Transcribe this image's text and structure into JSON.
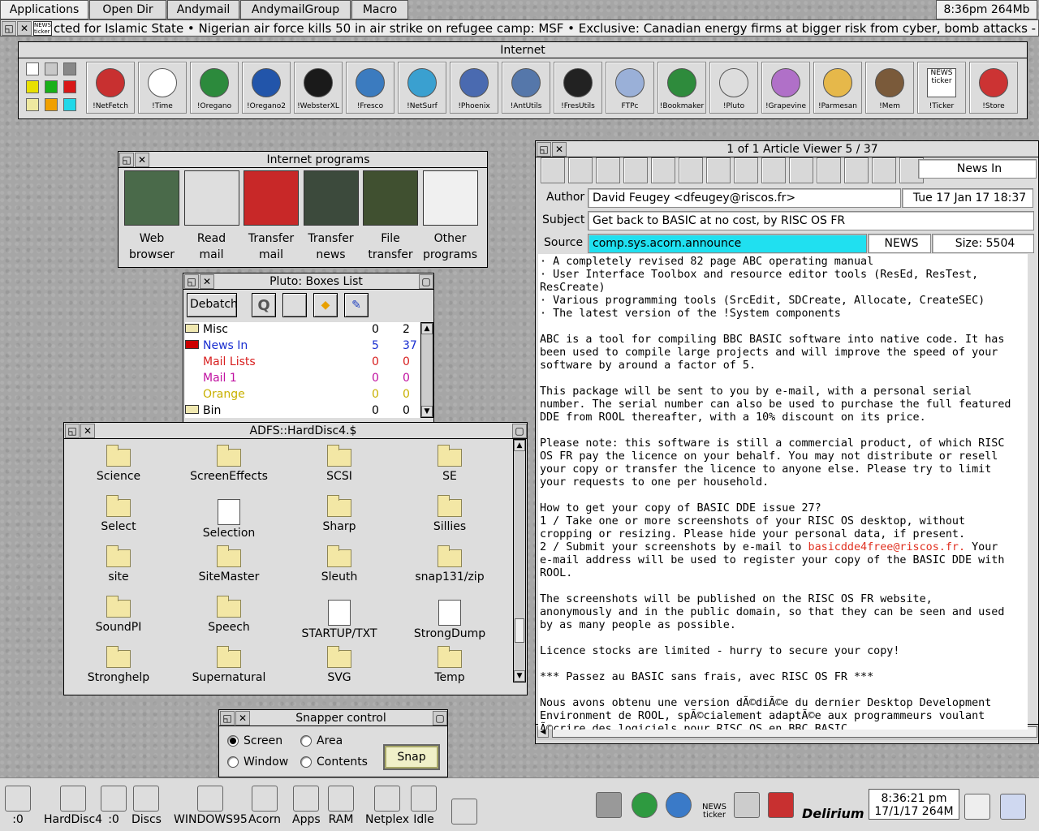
{
  "menubar": {
    "items": [
      "Applications",
      "Open Dir",
      "Andymail",
      "AndymailGroup",
      "Macro"
    ],
    "status": "8:36pm  264Mb"
  },
  "ticker": {
    "text": "cted for Islamic State  •  Nigerian air force kills 50 in air strike on refugee camp: MSF  •  Exclusive: Canadian energy firms at bigger risk from cyber, bomb attacks - spy agency  •  U.S",
    "badge": "NEWS ticker"
  },
  "internet": {
    "title": "Internet",
    "apps": [
      {
        "label": "!NetFetch",
        "icon": "netfetch-icon",
        "color": "#c83030"
      },
      {
        "label": "!Time",
        "icon": "clock-icon",
        "color": "#ffffff"
      },
      {
        "label": "!Oregano",
        "icon": "globe-icon",
        "color": "#2c8a3c"
      },
      {
        "label": "!Oregano2",
        "icon": "oregano2-icon",
        "color": "#2255aa"
      },
      {
        "label": "!WebsterXL",
        "icon": "webster-icon",
        "color": "#1a1a1a"
      },
      {
        "label": "!Fresco",
        "icon": "earth-icon",
        "color": "#3b7bbf"
      },
      {
        "label": "!NetSurf",
        "icon": "netsurf-icon",
        "color": "#3aa0d0"
      },
      {
        "label": "!Phoenix",
        "icon": "phoenix-icon",
        "color": "#4a6ab0"
      },
      {
        "label": "!AntUtils",
        "icon": "antutils-icon",
        "color": "#5577aa"
      },
      {
        "label": "!FresUtils",
        "icon": "tools-icon",
        "color": "#222222"
      },
      {
        "label": "FTPc",
        "icon": "ftp-icon",
        "color": "#9ab0d8"
      },
      {
        "label": "!Bookmaker",
        "icon": "book-icon",
        "color": "#2e8b3c"
      },
      {
        "label": "!Pluto",
        "icon": "pluto-icon",
        "color": "#dddddd"
      },
      {
        "label": "!Grapevine",
        "icon": "grapes-icon",
        "color": "#b070c8"
      },
      {
        "label": "!Parmesan",
        "icon": "cheese-icon",
        "color": "#e6b84a"
      },
      {
        "label": "!Mem",
        "icon": "photo-icon",
        "color": "#7a5a3a"
      },
      {
        "label": "!Ticker",
        "icon": "news-ticker-icon",
        "color": "#eeeeee"
      },
      {
        "label": "!Store",
        "icon": "store-icon",
        "color": "#cc3333"
      }
    ],
    "ticker_label": "NEWS ticker"
  },
  "programs": {
    "title": "Internet programs",
    "items": [
      {
        "l1": "Web",
        "l2": "browser"
      },
      {
        "l1": "Read",
        "l2": "mail"
      },
      {
        "l1": "Transfer",
        "l2": "mail"
      },
      {
        "l1": "Transfer",
        "l2": "news"
      },
      {
        "l1": "File",
        "l2": "transfer"
      },
      {
        "l1": "Other",
        "l2": "programs"
      }
    ]
  },
  "pluto": {
    "title": "Pluto:  Boxes List",
    "debatch": "Debatch",
    "rows": [
      {
        "name": "Misc",
        "a": "0",
        "b": "2",
        "color": "#000000"
      },
      {
        "name": "News In",
        "a": "5",
        "b": "37",
        "color": "#1a2fd0"
      },
      {
        "name": "Mail Lists",
        "a": "0",
        "b": "0",
        "color": "#d82020"
      },
      {
        "name": "Mail 1",
        "a": "0",
        "b": "0",
        "color": "#c010a0"
      },
      {
        "name": "Orange",
        "a": "0",
        "b": "0",
        "color": "#c8b000"
      },
      {
        "name": "Bin",
        "a": "0",
        "b": "0",
        "color": "#000000"
      }
    ]
  },
  "filer": {
    "title": "ADFS::HardDisc4.$",
    "items": [
      {
        "name": "Science",
        "kind": "folder"
      },
      {
        "name": "ScreenEffects",
        "kind": "folder"
      },
      {
        "name": "SCSI",
        "kind": "folder"
      },
      {
        "name": "SE",
        "kind": "folder"
      },
      {
        "name": "Select",
        "kind": "folder"
      },
      {
        "name": "Selection",
        "kind": "doc"
      },
      {
        "name": "Sharp",
        "kind": "folder"
      },
      {
        "name": "Sillies",
        "kind": "folder"
      },
      {
        "name": "site",
        "kind": "folder"
      },
      {
        "name": "SiteMaster",
        "kind": "folder"
      },
      {
        "name": "Sleuth",
        "kind": "folder"
      },
      {
        "name": "snap131/zip",
        "kind": "zip"
      },
      {
        "name": "SoundPI",
        "kind": "folder"
      },
      {
        "name": "Speech",
        "kind": "folder"
      },
      {
        "name": "STARTUP/TXT",
        "kind": "doc"
      },
      {
        "name": "StrongDump",
        "kind": "data"
      },
      {
        "name": "Stronghelp",
        "kind": "folder"
      },
      {
        "name": "Supernatural",
        "kind": "folder"
      },
      {
        "name": "SVG",
        "kind": "folder"
      },
      {
        "name": "Temp",
        "kind": "folder"
      }
    ]
  },
  "snapper": {
    "title": "Snapper control",
    "screen": "Screen",
    "area": "Area",
    "window": "Window",
    "contents": "Contents",
    "snap": "Snap"
  },
  "article": {
    "title": "1 of 1   Article Viewer  5 / 37",
    "box": "News In",
    "author_label": "Author",
    "author": "David Feugey <dfeugey@riscos.fr>",
    "date": "Tue 17 Jan 17 18:37",
    "subject_label": "Subject",
    "subject": "Get back to BASIC at no cost, by RISC OS FR",
    "source_label": "Source",
    "source": "comp.sys.acorn.announce",
    "type": "NEWS",
    "size": "Size: 5504",
    "body_1": "· A completely revised 82 page ABC operating manual\n· User Interface Toolbox and resource editor tools (ResEd, ResTest,\nResCreate)\n· Various programming tools (SrcEdit, SDCreate, Allocate, CreateSEC)\n· The latest version of the !System components\n\nABC is a tool for compiling BBC BASIC software into native code. It has\nbeen used to compile large projects and will improve the speed of your\nsoftware by around a factor of 5.\n\nThis package will be sent to you by e-mail, with a personal serial\nnumber. The serial number can also be used to purchase the full featured\nDDE from ROOL thereafter, with a 10% discount on its price.\n\nPlease note: this software is still a commercial product, of which RISC\nOS FR pay the licence on your behalf. You may not distribute or resell\nyour copy or transfer the licence to anyone else. Please try to limit\nyour requests to one per household.\n\nHow to get your copy of BASIC DDE issue 27?\n1 / Take one or more screenshots of your RISC OS desktop, without\ncropping or resizing. Please hide your personal data, if present.\n2 / Submit your screenshots by e-mail to ",
    "email": "basicdde4free@riscos.fr.",
    "body_2": " Your\ne-mail address will be used to register your copy of the BASIC DDE with\nROOL.\n\nThe screenshots will be published on the RISC OS FR website,\nanonymously and in the public domain, so that they can be seen and used\nby as many people as possible.\n\nLicence stocks are limited - hurry to secure your copy!\n\n*** Passez au BASIC sans frais, avec RISC OS FR ***\n\nNous avons obtenu une version dÃ©diÃ©e du dernier Desktop Development\nEnvironment de ROOL, spÃ©cialement adaptÃ©e aux programmeurs voulant\nÃ©crire des logiciels pour RISC OS en BBC BASIC."
  },
  "iconbar": {
    "left": [
      {
        "label": ":0",
        "icon": "cd-drive-icon"
      },
      {
        "label": "HardDisc4",
        "icon": "harddisc-icon"
      },
      {
        "label": ":0",
        "icon": "floppy-icon"
      },
      {
        "label": "Discs",
        "icon": "discs-icon"
      },
      {
        "label": "WINDOWS95",
        "icon": "drive-icon"
      },
      {
        "label": "Acorn",
        "icon": "acorn-drive-icon"
      },
      {
        "label": "Apps",
        "icon": "apps-icon"
      },
      {
        "label": "RAM",
        "icon": "ram-icon"
      },
      {
        "label": "Netplex",
        "icon": "netplex-icon"
      },
      {
        "label": "Idle",
        "icon": "idle-icon"
      },
      {
        "label": "",
        "icon": "snapper-icon"
      }
    ],
    "right": {
      "ticker": "NEWS ticker",
      "delirium": "Delirium",
      "clock_time": "8:36:21 pm",
      "clock_date": "17/1/17 264M"
    }
  }
}
